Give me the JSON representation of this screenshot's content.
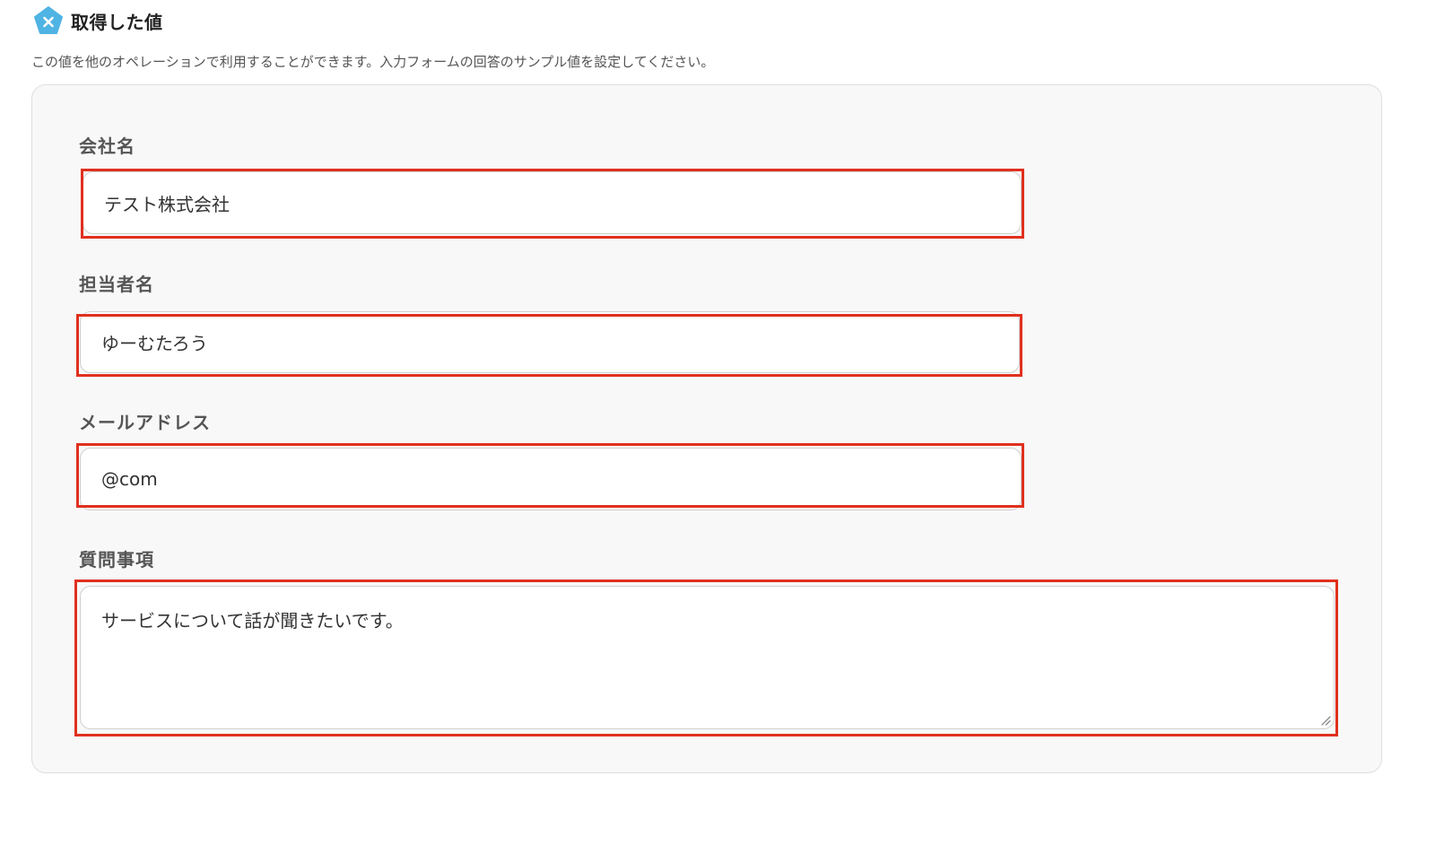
{
  "header": {
    "icon": "pentagon-x-icon",
    "title": "取得した値"
  },
  "description": "この値を他のオペレーションで利用することができます。入力フォームの回答のサンプル値を設定してください。",
  "fields": [
    {
      "label": "会社名",
      "value": "テスト株式会社"
    },
    {
      "label": "担当者名",
      "value": "ゆーむたろう"
    },
    {
      "label": "メールアドレス",
      "value": "@com"
    },
    {
      "label": "質問事項",
      "value": "サービスについて話が聞きたいです。"
    }
  ],
  "colors": {
    "accent": "#4fb3e3",
    "highlight": "#e0301e",
    "panel_background": "#f8f8f8"
  }
}
